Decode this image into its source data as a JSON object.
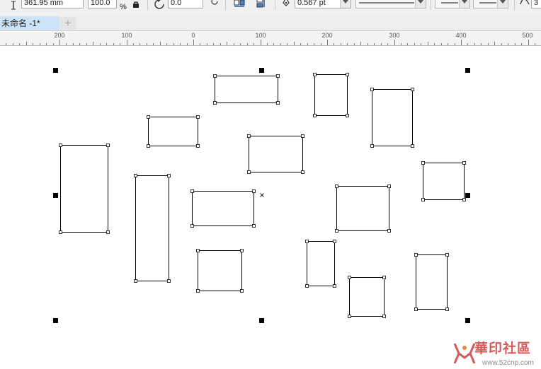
{
  "property_bar": {
    "height_field": "361.95 mm",
    "scale_field": "100.0",
    "scale_unit": "%",
    "rotation_field": "0.0",
    "outline_width_field": "0.567 pt",
    "extra_field": "3"
  },
  "tab_bar": {
    "document_tab": "未命名 -1*",
    "new_tab_symbol": "+"
  },
  "ruler": {
    "labels": [
      "200",
      "100",
      "0",
      "100",
      "200",
      "300",
      "400",
      "500"
    ]
  },
  "watermark": {
    "text": "華印社區",
    "url": "www.52cnp.com"
  }
}
